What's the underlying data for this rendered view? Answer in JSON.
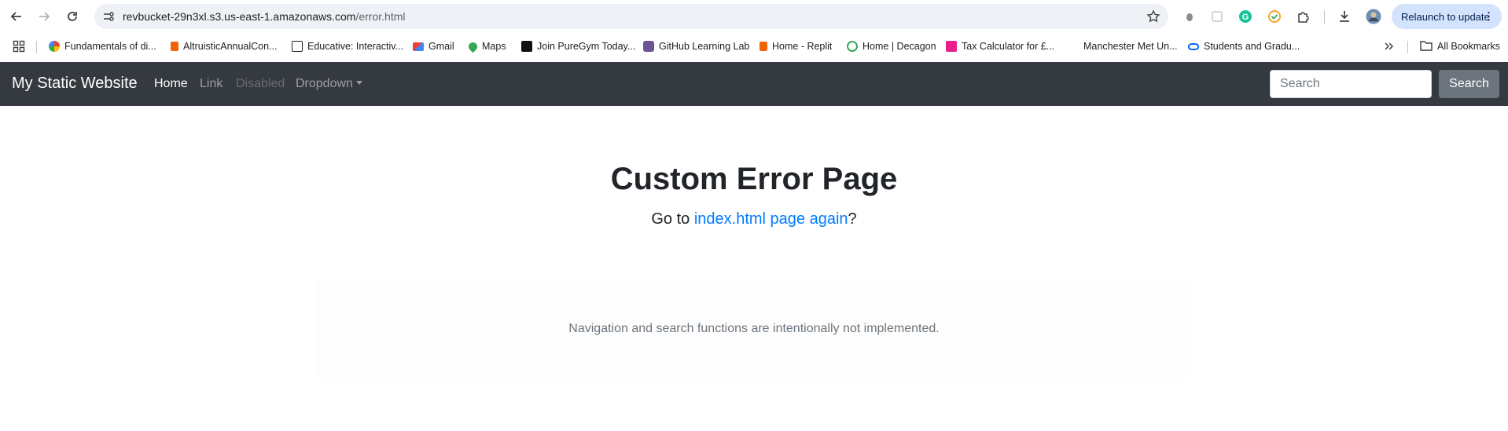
{
  "browser": {
    "url_host": "revbucket-29n3xl.s3.us-east-1.amazonaws.com",
    "url_path": "/error.html",
    "relaunch_label": "Relaunch to update",
    "bookmarks": [
      {
        "label": "Fundamentals of di...",
        "color": "#4285f4"
      },
      {
        "label": "AltruisticAnnualCon...",
        "color": "#f26207"
      },
      {
        "label": "Educative: Interactiv...",
        "color": "#202124"
      },
      {
        "label": "Gmail",
        "color": "#ea4335"
      },
      {
        "label": "Maps",
        "color": "#34a853"
      },
      {
        "label": "Join PureGym Today...",
        "color": "#111111"
      },
      {
        "label": "GitHub Learning Lab",
        "color": "#6e5494"
      },
      {
        "label": "Home - Replit",
        "color": "#f26207"
      },
      {
        "label": "Home | Decagon",
        "color": "#34a853"
      },
      {
        "label": "Tax Calculator for £...",
        "color": "#e91e8c"
      },
      {
        "label": "Manchester Met Un...",
        "color": "#ffffff"
      },
      {
        "label": "Students and Gradu...",
        "color": "#0866ff"
      }
    ],
    "all_bookmarks_label": "All Bookmarks"
  },
  "navbar": {
    "brand": "My Static Website",
    "home": "Home",
    "link": "Link",
    "disabled": "Disabled",
    "dropdown": "Dropdown",
    "search_placeholder": "Search",
    "search_button": "Search"
  },
  "main": {
    "title": "Custom Error Page",
    "subtitle_prefix": "Go to ",
    "subtitle_link": "index.html page again",
    "subtitle_suffix": "?",
    "note": "Navigation and search functions are intentionally not implemented."
  },
  "colors": {
    "navbar_bg": "#343a40",
    "link": "#007bff",
    "button_secondary": "#6c757d"
  }
}
